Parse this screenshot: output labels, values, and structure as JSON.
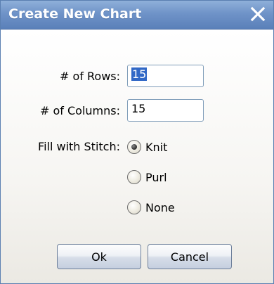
{
  "dialog": {
    "title": "Create New Chart",
    "close_icon": "close-icon"
  },
  "form": {
    "rows_label": "# of Rows:",
    "rows_value": "15",
    "columns_label": "# of Columns:",
    "columns_value": "15",
    "stitch_label": "Fill with Stitch:",
    "stitch_options": [
      {
        "label": "Knit",
        "selected": true
      },
      {
        "label": "Purl",
        "selected": false
      },
      {
        "label": "None",
        "selected": false
      }
    ]
  },
  "buttons": {
    "ok": "Ok",
    "cancel": "Cancel"
  }
}
